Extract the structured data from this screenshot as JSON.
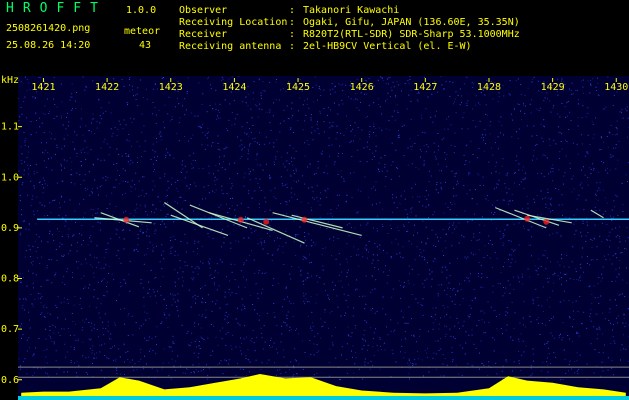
{
  "header": {
    "app_title": "HROFFT",
    "app_version": "1.0.0",
    "file_name": "2508261420.png",
    "timestamp": "25.08.26 14:20",
    "meteor_label": "meteor",
    "meteor_count": "43",
    "info": [
      {
        "label": "Observer",
        "value": "Takanori Kawachi"
      },
      {
        "label": "Receiving Location",
        "value": "Ogaki, Gifu, JAPAN (136.60E, 35.35N)"
      },
      {
        "label": "Receiver",
        "value": "R820T2(RTL-SDR) SDR-Sharp 53.1000MHz"
      },
      {
        "label": "Receiving antenna",
        "value": "2el-HB9CV Vertical (el. E-W)"
      }
    ]
  },
  "chart_data": {
    "type": "heatmap",
    "subtype": "spectrogram",
    "ylabel": "kHz",
    "x_ticks": [
      "1421",
      "1422",
      "1423",
      "1424",
      "1425",
      "1426",
      "1427",
      "1428",
      "1429",
      "1430"
    ],
    "x_range": [
      1420.6,
      1430.2
    ],
    "y_ticks": [
      "1.1",
      "1.0",
      "0.9",
      "0.8",
      "0.7",
      "0.6"
    ],
    "y_range": [
      0.56,
      1.2
    ],
    "carrier_line": {
      "y": 0.917,
      "x": [
        1420.9,
        1430.2
      ]
    },
    "reference_lines_y": [
      0.625,
      0.605
    ],
    "meteor_echoes": [
      {
        "x_start": 1421.9,
        "y_start": 0.93,
        "x_end": 1422.5,
        "y_end": 0.902
      },
      {
        "x_start": 1421.8,
        "y_start": 0.92,
        "x_end": 1422.7,
        "y_end": 0.91
      },
      {
        "x_start": 1422.9,
        "y_start": 0.95,
        "x_end": 1423.5,
        "y_end": 0.9
      },
      {
        "x_start": 1423.3,
        "y_start": 0.945,
        "x_end": 1424.2,
        "y_end": 0.9
      },
      {
        "x_start": 1423.0,
        "y_start": 0.925,
        "x_end": 1423.9,
        "y_end": 0.885
      },
      {
        "x_start": 1423.6,
        "y_start": 0.93,
        "x_end": 1424.6,
        "y_end": 0.895
      },
      {
        "x_start": 1424.2,
        "y_start": 0.92,
        "x_end": 1425.1,
        "y_end": 0.87
      },
      {
        "x_start": 1424.6,
        "y_start": 0.93,
        "x_end": 1426.0,
        "y_end": 0.885
      },
      {
        "x_start": 1424.9,
        "y_start": 0.925,
        "x_end": 1425.7,
        "y_end": 0.9
      },
      {
        "x_start": 1428.1,
        "y_start": 0.94,
        "x_end": 1428.9,
        "y_end": 0.9
      },
      {
        "x_start": 1428.4,
        "y_start": 0.935,
        "x_end": 1429.1,
        "y_end": 0.905
      },
      {
        "x_start": 1428.6,
        "y_start": 0.925,
        "x_end": 1429.3,
        "y_end": 0.91
      },
      {
        "x_start": 1429.6,
        "y_start": 0.935,
        "x_end": 1429.8,
        "y_end": 0.92
      }
    ],
    "bright_spots": [
      {
        "x": 1422.3,
        "y": 0.916
      },
      {
        "x": 1424.1,
        "y": 0.916
      },
      {
        "x": 1424.5,
        "y": 0.912
      },
      {
        "x": 1425.1,
        "y": 0.916
      },
      {
        "x": 1428.6,
        "y": 0.918
      },
      {
        "x": 1428.9,
        "y": 0.912
      }
    ],
    "activity_profile": [
      {
        "x": 1420.65,
        "level": 0.15
      },
      {
        "x": 1421.0,
        "level": 0.2
      },
      {
        "x": 1421.4,
        "level": 0.2
      },
      {
        "x": 1421.9,
        "level": 0.35
      },
      {
        "x": 1422.2,
        "level": 0.85
      },
      {
        "x": 1422.5,
        "level": 0.7
      },
      {
        "x": 1422.9,
        "level": 0.3
      },
      {
        "x": 1423.3,
        "level": 0.4
      },
      {
        "x": 1423.7,
        "level": 0.6
      },
      {
        "x": 1424.1,
        "level": 0.8
      },
      {
        "x": 1424.4,
        "level": 1.0
      },
      {
        "x": 1424.8,
        "level": 0.8
      },
      {
        "x": 1425.2,
        "level": 0.85
      },
      {
        "x": 1425.6,
        "level": 0.45
      },
      {
        "x": 1426.0,
        "level": 0.25
      },
      {
        "x": 1426.5,
        "level": 0.15
      },
      {
        "x": 1427.0,
        "level": 0.12
      },
      {
        "x": 1427.5,
        "level": 0.15
      },
      {
        "x": 1428.0,
        "level": 0.35
      },
      {
        "x": 1428.3,
        "level": 0.9
      },
      {
        "x": 1428.6,
        "level": 0.7
      },
      {
        "x": 1429.0,
        "level": 0.6
      },
      {
        "x": 1429.4,
        "level": 0.4
      },
      {
        "x": 1429.8,
        "level": 0.3
      },
      {
        "x": 1430.15,
        "level": 0.15
      }
    ],
    "colors": {
      "background": "#000033",
      "noise": "#2233cc",
      "carrier": "#33ccff",
      "echo": "#ccffcc",
      "hot": "#ff2222",
      "activity": "#ffff00",
      "reference_line": "#888888",
      "label": "#ffff00"
    }
  }
}
